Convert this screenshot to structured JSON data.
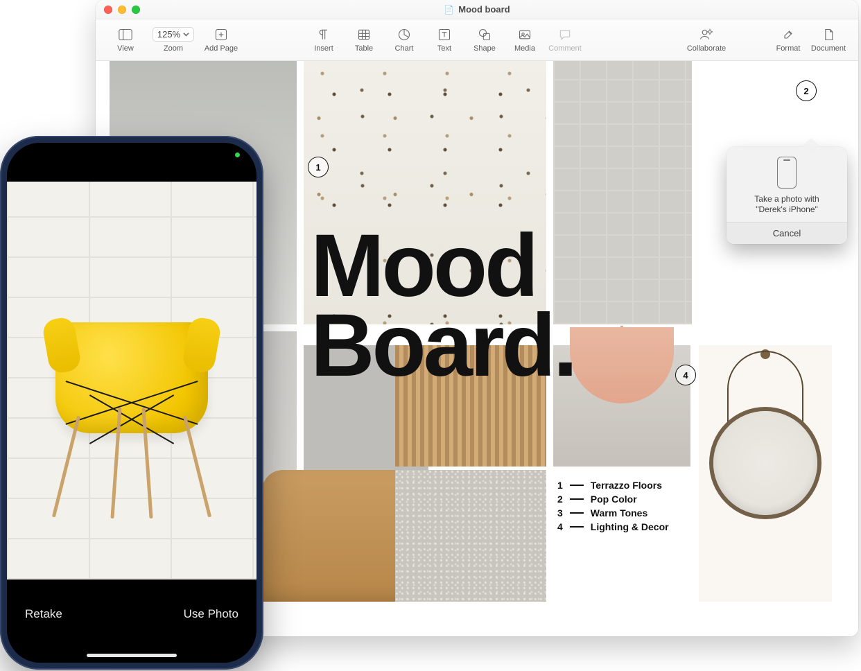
{
  "window": {
    "title": "Mood board",
    "traffic_colors": {
      "close": "#ff5f57",
      "minimize": "#febc2e",
      "zoom": "#28c840"
    }
  },
  "toolbar": {
    "view": "View",
    "zoom_label": "Zoom",
    "zoom_value": "125%",
    "add_page": "Add Page",
    "insert": "Insert",
    "table": "Table",
    "chart": "Chart",
    "text": "Text",
    "shape": "Shape",
    "media": "Media",
    "comment": "Comment",
    "collaborate": "Collaborate",
    "format": "Format",
    "document": "Document"
  },
  "moodboard": {
    "title_line1": "Mood",
    "title_line2": "Board.",
    "badges": {
      "b1": "1",
      "b2": "2",
      "b4": "4"
    },
    "legend": [
      {
        "num": "1",
        "label": "Terrazzo Floors"
      },
      {
        "num": "2",
        "label": "Pop Color"
      },
      {
        "num": "3",
        "label": "Warm Tones"
      },
      {
        "num": "4",
        "label": "Lighting & Decor"
      }
    ]
  },
  "popover": {
    "line1": "Take a photo with",
    "line2": "\"Derek's iPhone\"",
    "cancel": "Cancel"
  },
  "iphone": {
    "retake": "Retake",
    "use_photo": "Use Photo"
  }
}
